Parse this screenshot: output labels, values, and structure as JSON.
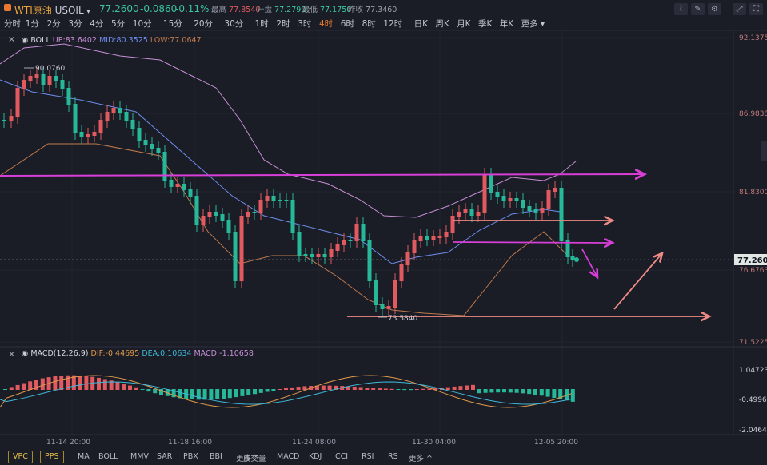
{
  "header": {
    "symbol": "WTI原油",
    "code": "USOIL",
    "price": "77.2600",
    "change": "-0.0860",
    "change_pct": "-0.11%",
    "high_label": "最高",
    "high": "77.8540",
    "open_label": "开盘",
    "open": "77.2790",
    "low_label": "最低",
    "low": "77.1750",
    "prev_label": "昨收",
    "prev": "77.3460"
  },
  "timeframes": [
    "分时",
    "1分",
    "2分",
    "3分",
    "4分",
    "5分",
    "10分",
    "15分",
    "20分",
    "30分",
    "1时",
    "2时",
    "3时",
    "4时",
    "6时",
    "8时",
    "12时",
    "日K",
    "周K",
    "月K",
    "季K",
    "年K",
    "更多"
  ],
  "active_timeframe": "4时",
  "boll": {
    "name": "BOLL",
    "up": "UP:83.6402",
    "mid": "MID:80.3525",
    "low": "LOW:77.0647",
    "up_color": "#c78fd6",
    "mid_color": "#6e8ff0",
    "low_color": "#c07a4c"
  },
  "macd": {
    "name": "MACD(12,26,9)",
    "dif": "DIF:-0.44695",
    "dea": "DEA:0.10634",
    "macd": "MACD:-1.10658",
    "dif_color": "#e09a4a",
    "dea_color": "#3fb8d8",
    "macd_color": "#c78fd6"
  },
  "price_axis": [
    "92.1375",
    "86.9838",
    "81.8300",
    "76.6763",
    "71.5225"
  ],
  "current_price_tag": "77.2600",
  "macd_axis": [
    "1.04723",
    "-0.49961",
    "-2.04646"
  ],
  "time_axis": [
    "11-14 20:00",
    "11-18 16:00",
    "11-24 08:00",
    "11-30 04:00",
    "12-05 20:00"
  ],
  "annotations": {
    "high_label": "90.0760",
    "low_label": "73.5840"
  },
  "footer": {
    "buttons": [
      "VPC",
      "PPS"
    ],
    "main_indicators": [
      "MA",
      "BOLL",
      "MMV",
      "SAR",
      "PBX",
      "BBI",
      "更多"
    ],
    "sub_indicators": [
      "成交量",
      "MACD",
      "KDJ",
      "CCI",
      "RSI",
      "RS",
      "更多"
    ]
  },
  "colors": {
    "up": "#e05a5f",
    "down": "#27b89a",
    "bg": "#1a1c26",
    "accent": "#e8792f",
    "pink_line": "#d83fd8",
    "salmon_line": "#ef8a86"
  }
}
